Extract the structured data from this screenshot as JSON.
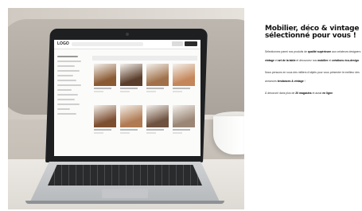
{
  "headline": [
    "Mobilier, déco & vintage",
    "sélectionné pour vous !"
  ],
  "paragraphs": [
    [
      {
        "t": "Sélectionnez parmi nos produits de ",
        "b": false
      },
      {
        "t": "qualité supérieure",
        "b": true
      },
      {
        "t": " aux ",
        "b": false
      },
      {
        "t": "créateurs designers",
        "b": false
      },
      {
        "t": " vintage",
        "b": true
      },
      {
        "t": " et ",
        "b": false
      },
      {
        "t": "art de la table",
        "b": true
      },
      {
        "t": " et découvrez nos ",
        "b": false
      },
      {
        "t": "mobilier",
        "b": true
      },
      {
        "t": " et ",
        "b": false
      },
      {
        "t": "créations éco-design",
        "b": true
      },
      {
        "t": ".",
        "b": false
      }
    ],
    [
      {
        "t": "Nous pensons en vous des milliers d'objets pour vous présenter le meilleur des annonces ",
        "b": false
      },
      {
        "t": "tendances & vintage",
        "b": true
      },
      {
        "t": " !",
        "b": false
      }
    ],
    [
      {
        "t": "À découvrir dans plus de ",
        "b": false
      },
      {
        "t": "20 magasins",
        "b": true
      },
      {
        "t": " et aussi ",
        "b": false
      },
      {
        "t": "en ligne",
        "b": true
      },
      {
        "t": ".",
        "b": false
      }
    ]
  ],
  "screen_site": {
    "logo": "LOGO",
    "products": [
      {
        "color": "#8a5a33"
      },
      {
        "color": "#5a3d2a"
      },
      {
        "color": "#a0714a"
      },
      {
        "color": "#c4865a"
      },
      {
        "color": "#7d4f31"
      },
      {
        "color": "#b07a52"
      },
      {
        "color": "#6f5240"
      },
      {
        "color": "#9b8676"
      }
    ]
  },
  "colors": {
    "headline": "#111111",
    "body": "#333333",
    "laptop_bezel": "#1e1f21"
  }
}
